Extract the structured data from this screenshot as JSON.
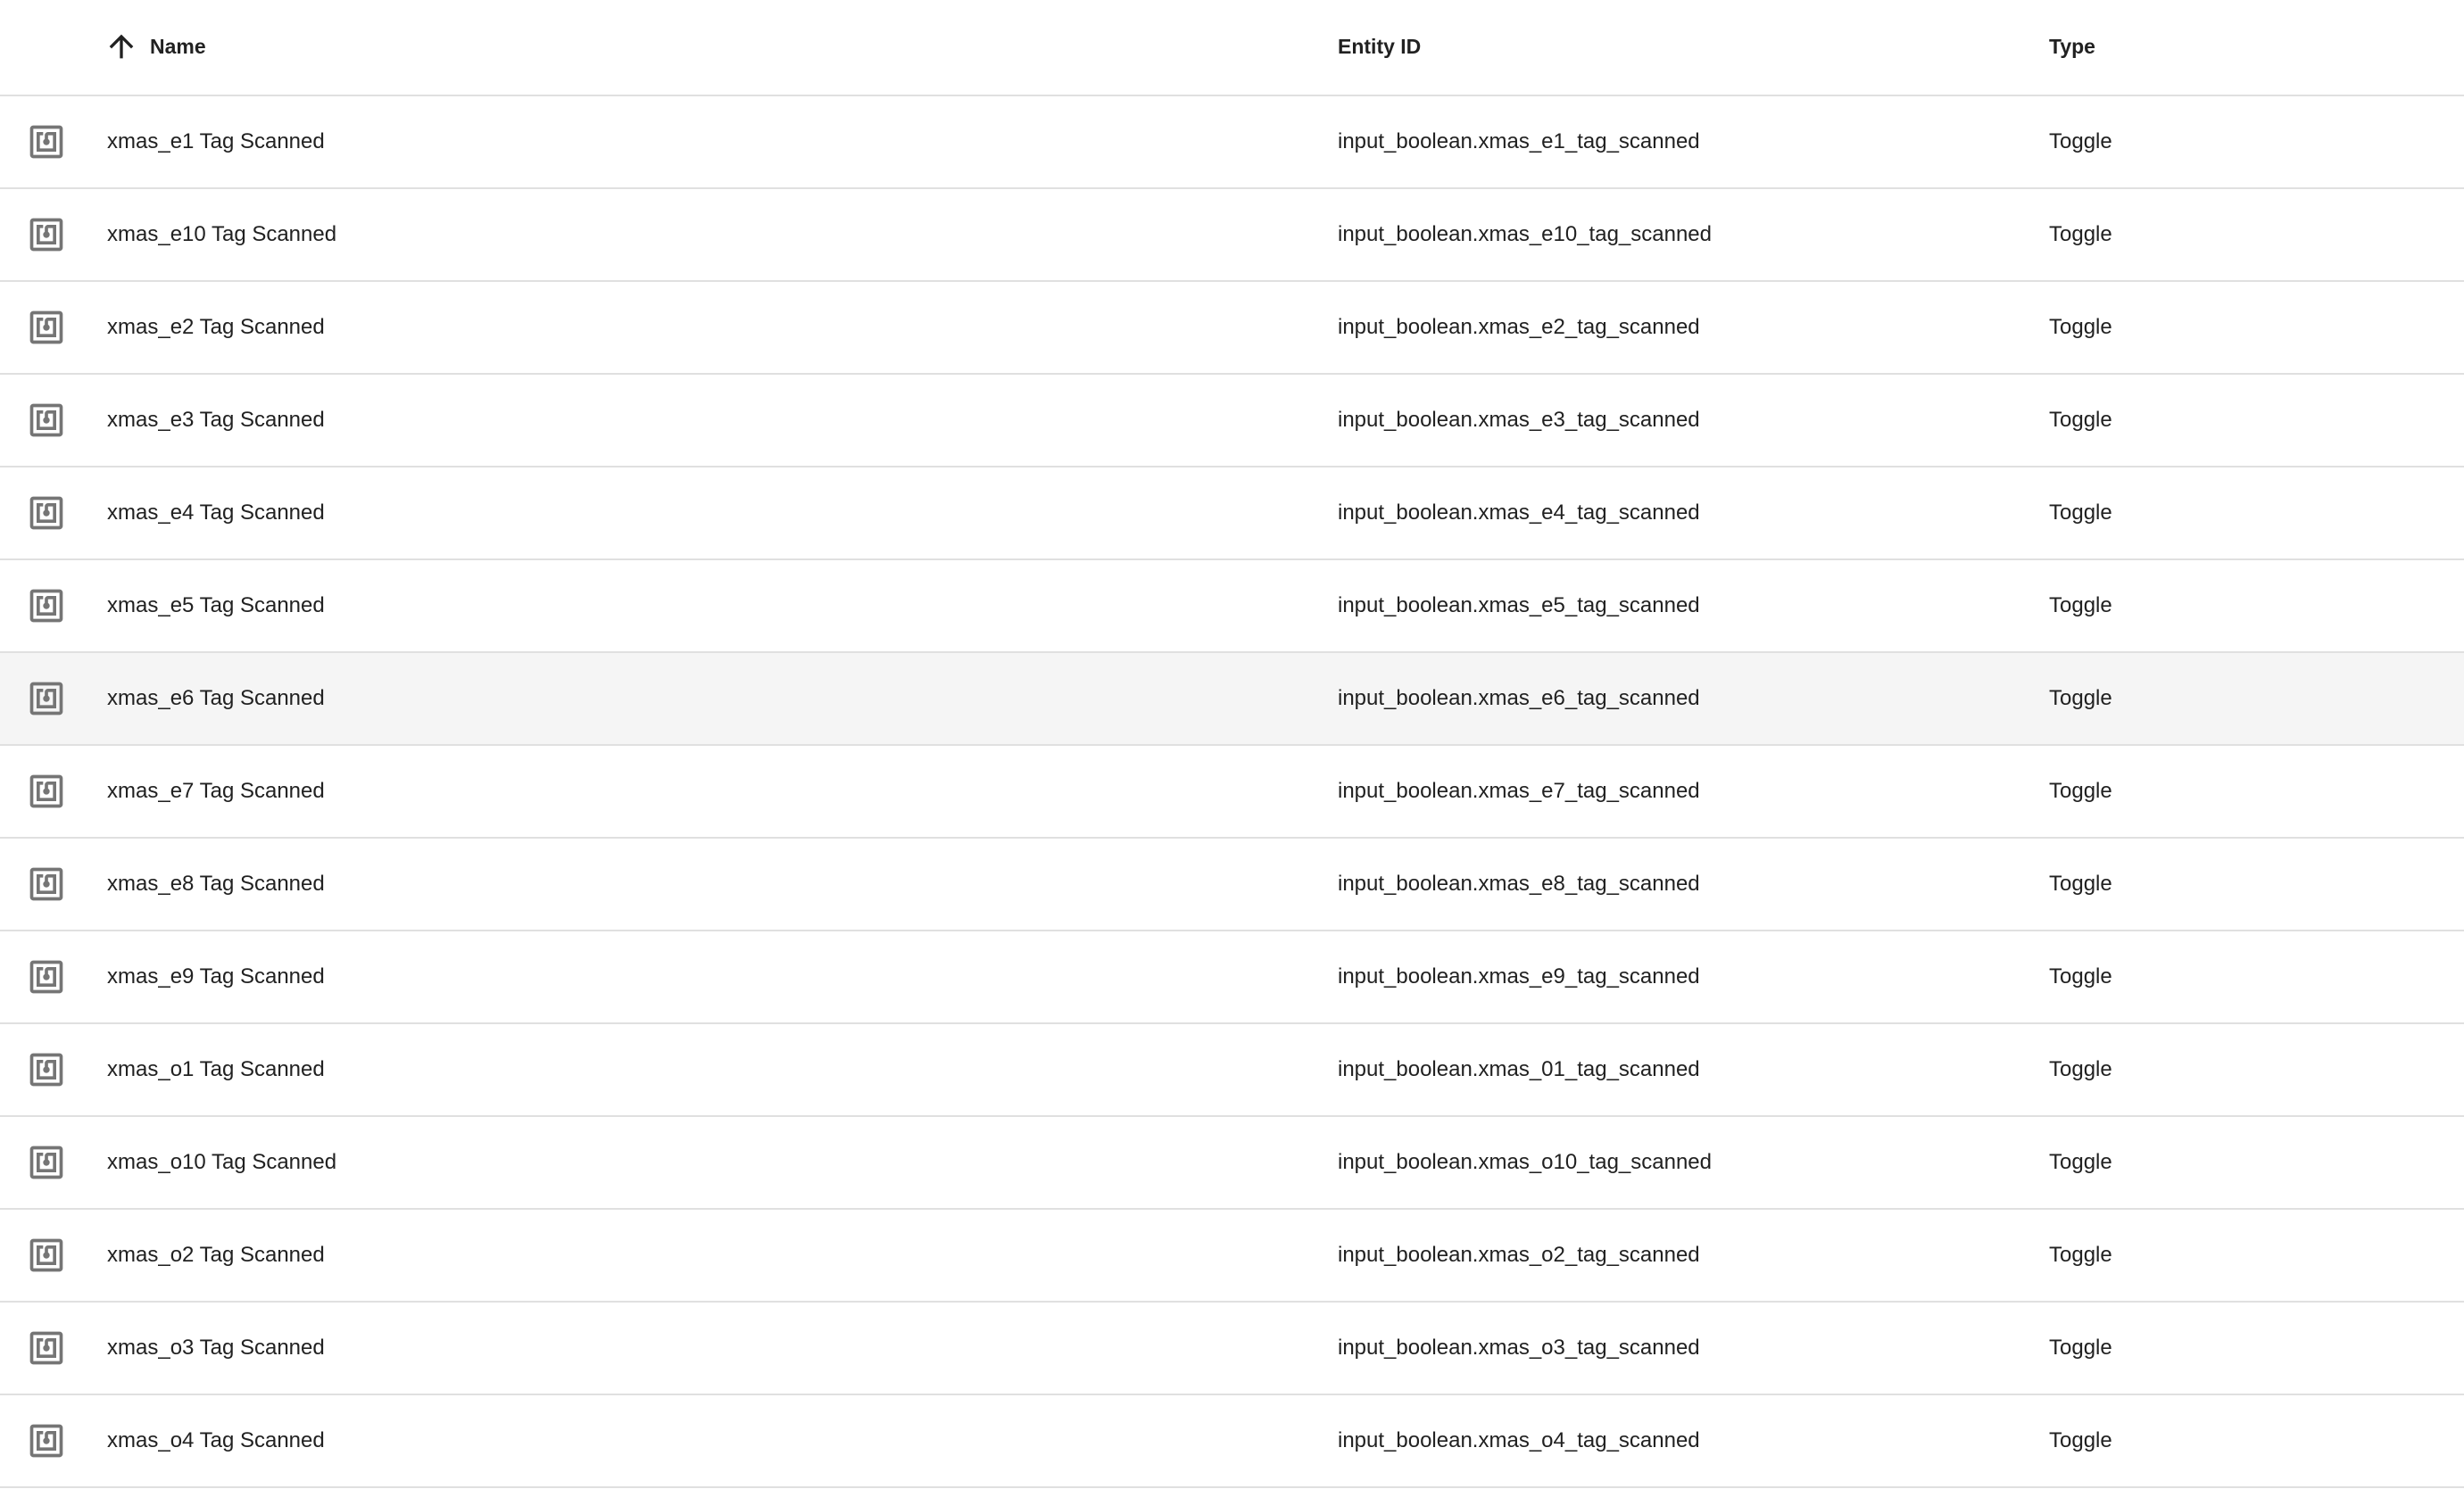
{
  "columns": {
    "name": "Name",
    "entity_id": "Entity ID",
    "type": "Type"
  },
  "sort": {
    "column": "name",
    "direction": "ascending",
    "icon": "arrow-up-icon"
  },
  "row_icon": "nfc-icon",
  "hovered_row_index": 6,
  "rows": [
    {
      "name": "xmas_e1 Tag Scanned",
      "entity_id": "input_boolean.xmas_e1_tag_scanned",
      "type": "Toggle"
    },
    {
      "name": "xmas_e10 Tag Scanned",
      "entity_id": "input_boolean.xmas_e10_tag_scanned",
      "type": "Toggle"
    },
    {
      "name": "xmas_e2 Tag Scanned",
      "entity_id": "input_boolean.xmas_e2_tag_scanned",
      "type": "Toggle"
    },
    {
      "name": "xmas_e3 Tag Scanned",
      "entity_id": "input_boolean.xmas_e3_tag_scanned",
      "type": "Toggle"
    },
    {
      "name": "xmas_e4 Tag Scanned",
      "entity_id": "input_boolean.xmas_e4_tag_scanned",
      "type": "Toggle"
    },
    {
      "name": "xmas_e5 Tag Scanned",
      "entity_id": "input_boolean.xmas_e5_tag_scanned",
      "type": "Toggle"
    },
    {
      "name": "xmas_e6 Tag Scanned",
      "entity_id": "input_boolean.xmas_e6_tag_scanned",
      "type": "Toggle"
    },
    {
      "name": "xmas_e7 Tag Scanned",
      "entity_id": "input_boolean.xmas_e7_tag_scanned",
      "type": "Toggle"
    },
    {
      "name": "xmas_e8 Tag Scanned",
      "entity_id": "input_boolean.xmas_e8_tag_scanned",
      "type": "Toggle"
    },
    {
      "name": "xmas_e9 Tag Scanned",
      "entity_id": "input_boolean.xmas_e9_tag_scanned",
      "type": "Toggle"
    },
    {
      "name": "xmas_o1 Tag Scanned",
      "entity_id": "input_boolean.xmas_01_tag_scanned",
      "type": "Toggle"
    },
    {
      "name": "xmas_o10 Tag Scanned",
      "entity_id": "input_boolean.xmas_o10_tag_scanned",
      "type": "Toggle"
    },
    {
      "name": "xmas_o2 Tag Scanned",
      "entity_id": "input_boolean.xmas_o2_tag_scanned",
      "type": "Toggle"
    },
    {
      "name": "xmas_o3 Tag Scanned",
      "entity_id": "input_boolean.xmas_o3_tag_scanned",
      "type": "Toggle"
    },
    {
      "name": "xmas_o4 Tag Scanned",
      "entity_id": "input_boolean.xmas_o4_tag_scanned",
      "type": "Toggle"
    }
  ]
}
